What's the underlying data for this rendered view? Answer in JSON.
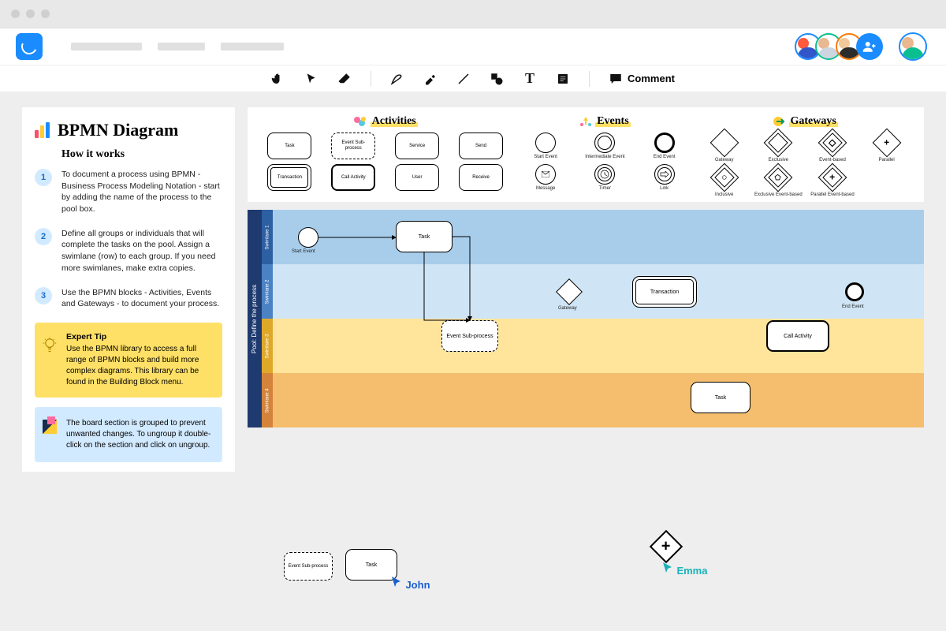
{
  "toolbar": {
    "comment": "Comment"
  },
  "sidebar": {
    "title": "BPMN Diagram",
    "subtitle": "How it works",
    "steps": [
      "To document a process using BPMN - Business Process Modeling Notation - start by adding the name of the process to the pool box.",
      "Define all groups or individuals that will complete the tasks on the pool. Assign a swimlane (row) to each group. If you need more swimlanes, make extra copies.",
      "Use the BPMN blocks - Activities, Events and Gateways - to document your process."
    ],
    "tip_title": "Expert Tip",
    "tip": "Use the BPMN library to access a full range of BPMN blocks and build more complex diagrams. This library can be found in the Building Block menu.",
    "note": "The board section is grouped to prevent unwanted changes. To ungroup it double-click on the section and click on ungroup."
  },
  "palette": {
    "activities": {
      "title": "Activities",
      "items": [
        "Task",
        "Event Sub-process",
        "Service",
        "Send",
        "Transaction",
        "Call Activity",
        "User",
        "Receive"
      ]
    },
    "events": {
      "title": "Events",
      "items": [
        "Start Event",
        "Intermediate Event",
        "End Event",
        "Message",
        "Timer",
        "Link"
      ]
    },
    "gateways": {
      "title": "Gateways",
      "items": [
        "Gateway",
        "Exclusive",
        "Event-based",
        "Parallel",
        "Inclusive",
        "Exclusive Event-based",
        "Parallel Event-based"
      ]
    }
  },
  "pool": {
    "label": "Pool: Define the process",
    "lanes": [
      "Swimlane 1",
      "Swimlane 2",
      "Swimlane 3",
      "Swimlane 4"
    ],
    "nodes": {
      "start": "Start Event",
      "task1": "Task",
      "subp": "Event Sub-process",
      "gateway": "Gateway",
      "trans": "Transaction",
      "call": "Call Activity",
      "task2": "Task",
      "end": "End Event"
    }
  },
  "floating": {
    "subp": "Event Sub-process",
    "task": "Task",
    "john": "John",
    "emma": "Emma"
  }
}
